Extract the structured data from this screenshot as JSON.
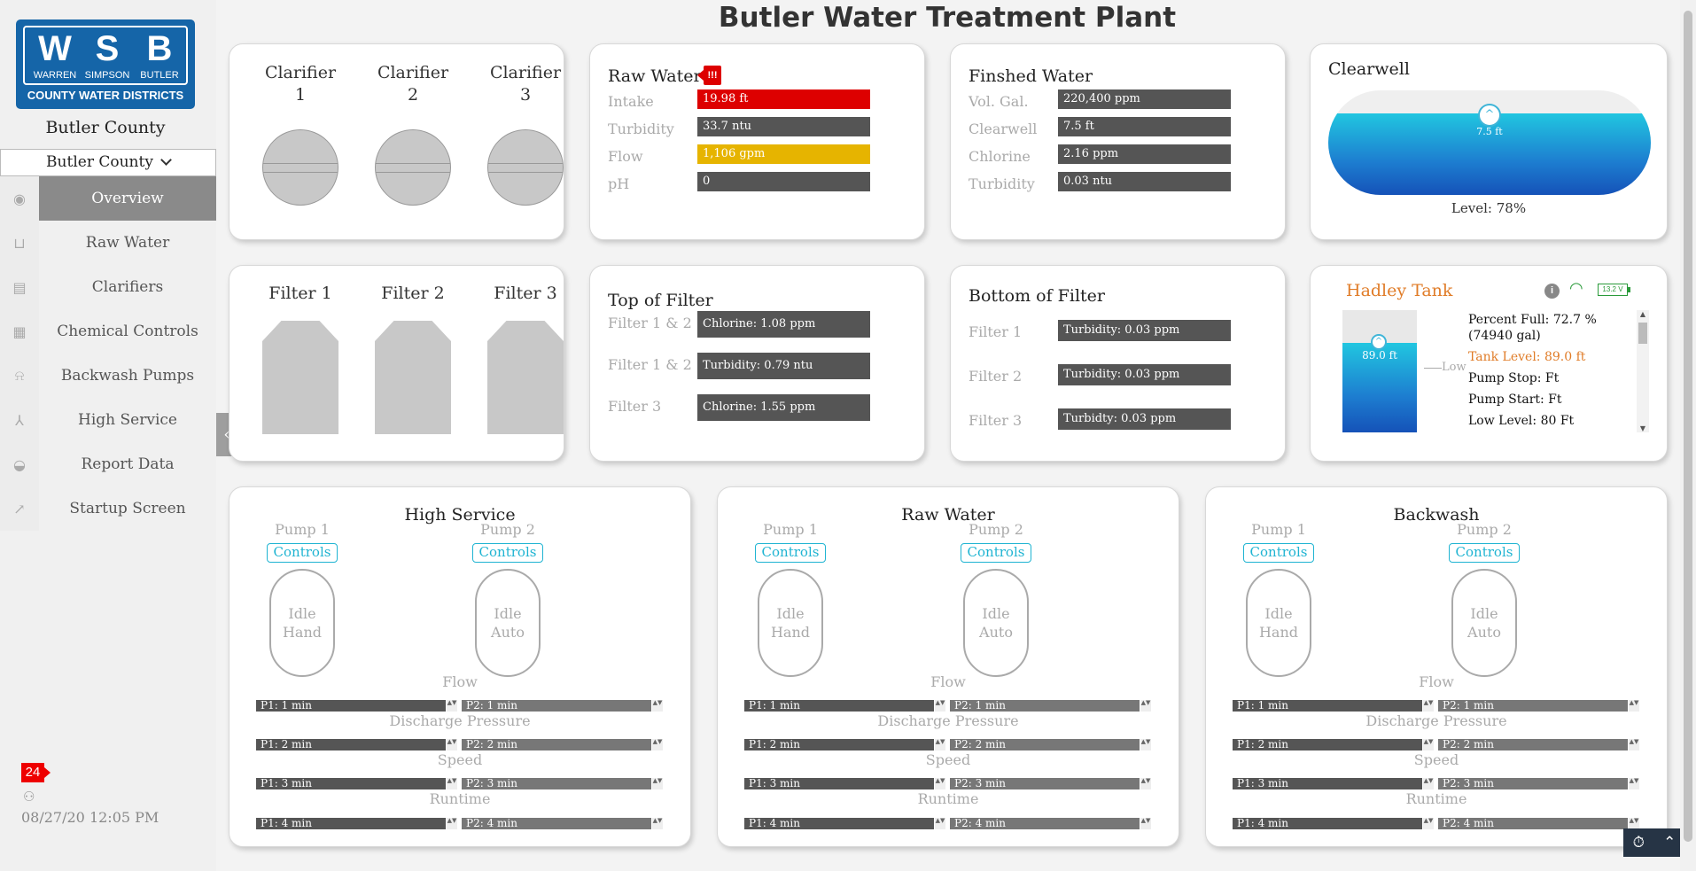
{
  "page": {
    "title": "Butler Water Treatment Plant"
  },
  "logo": {
    "letters": [
      "W",
      "S",
      "B"
    ],
    "names": [
      "WARREN",
      "SIMPSON",
      "BUTLER"
    ],
    "subtitle": "COUNTY WATER DISTRICTS"
  },
  "sidebar": {
    "county_title": "Butler County",
    "county_select": "Butler County",
    "collapse_icon": "‹",
    "nav": [
      {
        "label": "Overview",
        "icon": "eye-icon",
        "glyph": "◉"
      },
      {
        "label": "Raw Water",
        "icon": "faucet-icon",
        "glyph": "⊔"
      },
      {
        "label": "Clarifiers",
        "icon": "basin-icon",
        "glyph": "▤"
      },
      {
        "label": "Chemical Controls",
        "icon": "dashboard-icon",
        "glyph": "▦"
      },
      {
        "label": "Backwash Pumps",
        "icon": "bell-icon",
        "glyph": "⍾"
      },
      {
        "label": "High Service",
        "icon": "network-icon",
        "glyph": "⅄"
      },
      {
        "label": "Report Data",
        "icon": "droplet-icon",
        "glyph": "◒"
      },
      {
        "label": "Startup Screen",
        "icon": "trend-icon",
        "glyph": "↗"
      }
    ],
    "alarm_count": "24",
    "datetime": "08/27/20 12:05 PM"
  },
  "clarifiers": [
    {
      "line1": "Clarifier",
      "line2": "1"
    },
    {
      "line1": "Clarifier",
      "line2": "2"
    },
    {
      "line1": "Clarifier",
      "line2": "3"
    }
  ],
  "raw_water": {
    "title": "Raw Water",
    "alert_glyph": "!!!",
    "rows": [
      {
        "label": "Intake",
        "value": "19.98 ft",
        "status": "red"
      },
      {
        "label": "Turbidity",
        "value": "33.7 ntu",
        "status": "normal"
      },
      {
        "label": "Flow",
        "value": "1,106 gpm",
        "status": "yellow"
      },
      {
        "label": "pH",
        "value": "0",
        "status": "normal"
      }
    ]
  },
  "finished_water": {
    "title": "Finshed Water",
    "rows": [
      {
        "label": "Vol. Gal.",
        "value": "220,400 ppm"
      },
      {
        "label": "Clearwell",
        "value": "7.5 ft"
      },
      {
        "label": "Chlorine",
        "value": "2.16 ppm"
      },
      {
        "label": "Turbidity",
        "value": "0.03 ntu"
      }
    ]
  },
  "clearwell": {
    "title": "Clearwell",
    "marker_value": "7.5 ft",
    "level_text": "Level: 78%",
    "level_fraction": 0.78
  },
  "filters": [
    "Filter 1",
    "Filter 2",
    "Filter 3"
  ],
  "top_of_filter": {
    "title": "Top of Filter",
    "rows": [
      {
        "label": "Filter 1 & 2",
        "value": "Chlorine: 1.08 ppm"
      },
      {
        "label": "Filter 1 & 2",
        "value": "Turbidity: 0.79 ntu"
      },
      {
        "label": "Filter 3",
        "value": "Chlorine: 1.55 ppm"
      }
    ]
  },
  "bottom_of_filter": {
    "title": "Bottom of Filter",
    "rows": [
      {
        "label": "Filter 1",
        "value": "Turbidity: 0.03 ppm"
      },
      {
        "label": "Filter 2",
        "value": "Turbidity: 0.03 ppm"
      },
      {
        "label": "Filter 3",
        "value": "Turbidty: 0.03 ppm"
      }
    ]
  },
  "hadley": {
    "title": "Hadley Tank",
    "battery": "13.2 V",
    "marker_value": "89.0 ft",
    "low_label": "Low",
    "fill_fraction": 0.73,
    "info": [
      "Percent Full: 72.7 % (74940 gal)",
      "Tank Level: 89.0 ft",
      "Pump Stop: Ft",
      "Pump Start: Ft",
      "Low Level: 80 Ft"
    ]
  },
  "pump_cards": [
    {
      "title": "High Service",
      "pumps": [
        {
          "name": "Pump 1",
          "button": "Controls",
          "state": "Idle",
          "mode": "Hand"
        },
        {
          "name": "Pump 2",
          "button": "Controls",
          "state": "Idle",
          "mode": "Auto"
        }
      ],
      "metrics": [
        {
          "label": "Flow",
          "p1": "P1: 1 min",
          "p2": "P2: 1 min"
        },
        {
          "label": "Discharge Pressure",
          "p1": "P1: 2 min",
          "p2": "P2: 2 min"
        },
        {
          "label": "Speed",
          "p1": "P1: 3 min",
          "p2": "P2: 3 min"
        },
        {
          "label": "Runtime",
          "p1": "P1: 4 min",
          "p2": "P2: 4 min"
        }
      ]
    },
    {
      "title": "Raw Water",
      "pumps": [
        {
          "name": "Pump 1",
          "button": "Controls",
          "state": "Idle",
          "mode": "Hand"
        },
        {
          "name": "Pump 2",
          "button": "Controls",
          "state": "Idle",
          "mode": "Auto"
        }
      ],
      "metrics": [
        {
          "label": "Flow",
          "p1": "P1: 1 min",
          "p2": "P2: 1 min"
        },
        {
          "label": "Discharge Pressure",
          "p1": "P1: 2 min",
          "p2": "P2: 2 min"
        },
        {
          "label": "Speed",
          "p1": "P1: 3 min",
          "p2": "P2: 3 min"
        },
        {
          "label": "Runtime",
          "p1": "P1: 4 min",
          "p2": "P2: 4 min"
        }
      ]
    },
    {
      "title": "Backwash",
      "pumps": [
        {
          "name": "Pump 1",
          "button": "Controls",
          "state": "Idle",
          "mode": "Hand"
        },
        {
          "name": "Pump 2",
          "button": "Controls",
          "state": "Idle",
          "mode": "Auto"
        }
      ],
      "metrics": [
        {
          "label": "Flow",
          "p1": "P1: 1 min",
          "p2": "P2: 1 min"
        },
        {
          "label": "Discharge Pressure",
          "p1": "P1: 2 min",
          "p2": "P2: 2 min"
        },
        {
          "label": "Speed",
          "p1": "P1: 3 min",
          "p2": "P2: 3 min"
        },
        {
          "label": "Runtime",
          "p1": "P1: 4 min",
          "p2": "P2: 4 min"
        }
      ]
    }
  ],
  "colors": {
    "accent": "#1fb4d2",
    "alarm": "#dd0000",
    "warning": "#e6b400",
    "brand": "#1565a8",
    "hadley_title": "#e07c28"
  }
}
